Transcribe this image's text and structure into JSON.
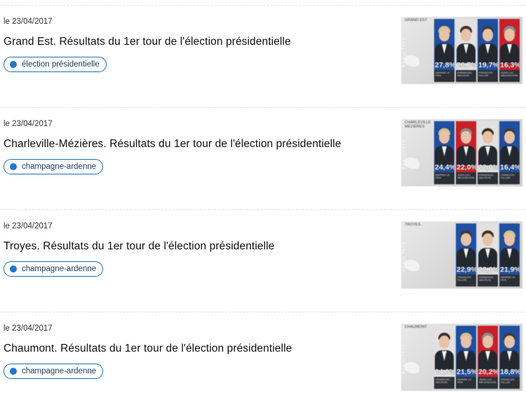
{
  "articles": [
    {
      "date": "le 23/04/2017",
      "title": "Grand Est. Résultats du 1er tour de l'élection présidentielle",
      "tag": "élection présidentielle",
      "thumb": {
        "region": "GRAND EST",
        "side": "RÉSULTATS",
        "candidates": [
          {
            "score": "27,8%",
            "name": "MARINE LE PEN",
            "bg": "#1f4fa0",
            "hair": "#d8c28e",
            "suit": "#23272e"
          },
          {
            "score": "20,7%",
            "name": "EMMANUEL MACRON",
            "bg": "#e2e2e2",
            "hair": "#3a2d22",
            "suit": "#23272e"
          },
          {
            "score": "19,7%",
            "name": "FRANÇOIS FILLON",
            "bg": "#1f4fa0",
            "hair": "#3b3b3b",
            "suit": "#23272e"
          },
          {
            "score": "16,3%",
            "name": "JEAN-LUC MÉLENCHON",
            "bg": "#c8202a",
            "hair": "#8a8a8a",
            "suit": "#23272e"
          }
        ]
      }
    },
    {
      "date": "le 23/04/2017",
      "title": "Charleville-Mézières. Résultats du 1er tour de l'élection présidentielle",
      "tag": "champagne-ardenne",
      "thumb": {
        "region": "CHARLEVILLE MÉZIÈRES",
        "side": "RÉSULTATS",
        "candidates": [
          {
            "score": "24,4%",
            "name": "MARINE LE PEN",
            "bg": "#1f4fa0",
            "hair": "#d8c28e",
            "suit": "#23272e"
          },
          {
            "score": "22,0%",
            "name": "JEAN-LUC MÉLENCHON",
            "bg": "#c8202a",
            "hair": "#8a8a8a",
            "suit": "#23272e"
          },
          {
            "score": "22,0%",
            "name": "EMMANUEL MACRON",
            "bg": "#e2e2e2",
            "hair": "#3a2d22",
            "suit": "#23272e"
          },
          {
            "score": "16,4%",
            "name": "FRANÇOIS FILLON",
            "bg": "#1f4fa0",
            "hair": "#3b3b3b",
            "suit": "#23272e"
          }
        ]
      }
    },
    {
      "date": "le 23/04/2017",
      "title": "Troyes. Résultats du 1er tour de l'élection présidentielle",
      "tag": "champagne-ardenne",
      "thumb": {
        "region": "TROYES",
        "side": "RÉSULTATS",
        "candidates": [
          {
            "score": "22,9%",
            "name": "FRANÇOIS FILLON",
            "bg": "#1f4fa0",
            "hair": "#3b3b3b",
            "suit": "#23272e"
          },
          {
            "score": "22,0%",
            "name": "EMMANUEL MACRON",
            "bg": "#e2e2e2",
            "hair": "#3a2d22",
            "suit": "#23272e"
          },
          {
            "score": "21,9%",
            "name": "MARINE LE PEN",
            "bg": "#1f4fa0",
            "hair": "#d8c28e",
            "suit": "#23272e"
          }
        ]
      }
    },
    {
      "date": "le 23/04/2017",
      "title": "Chaumont. Résultats du 1er tour de l'élection présidentielle",
      "tag": "champagne-ardenne",
      "thumb": {
        "region": "CHAUMONT",
        "side": "RÉSULTATS",
        "candidates": [
          {
            "score": "24,0%",
            "name": "EMMANUEL MACRON",
            "bg": "#e2e2e2",
            "hair": "#3a2d22",
            "suit": "#23272e"
          },
          {
            "score": "21,5%",
            "name": "MARINE LE PEN",
            "bg": "#1f4fa0",
            "hair": "#d8c28e",
            "suit": "#23272e"
          },
          {
            "score": "20,2%",
            "name": "JEAN-LUC MÉLENCHON",
            "bg": "#c8202a",
            "hair": "#8a8a8a",
            "suit": "#23272e"
          },
          {
            "score": "18,8%",
            "name": "FRANÇOIS FILLON",
            "bg": "#1f4fa0",
            "hair": "#3b3b3b",
            "suit": "#23272e"
          }
        ]
      }
    }
  ],
  "colors": {
    "tag_border": "#1d6fb8",
    "tag_dot": "#1d78d0"
  }
}
